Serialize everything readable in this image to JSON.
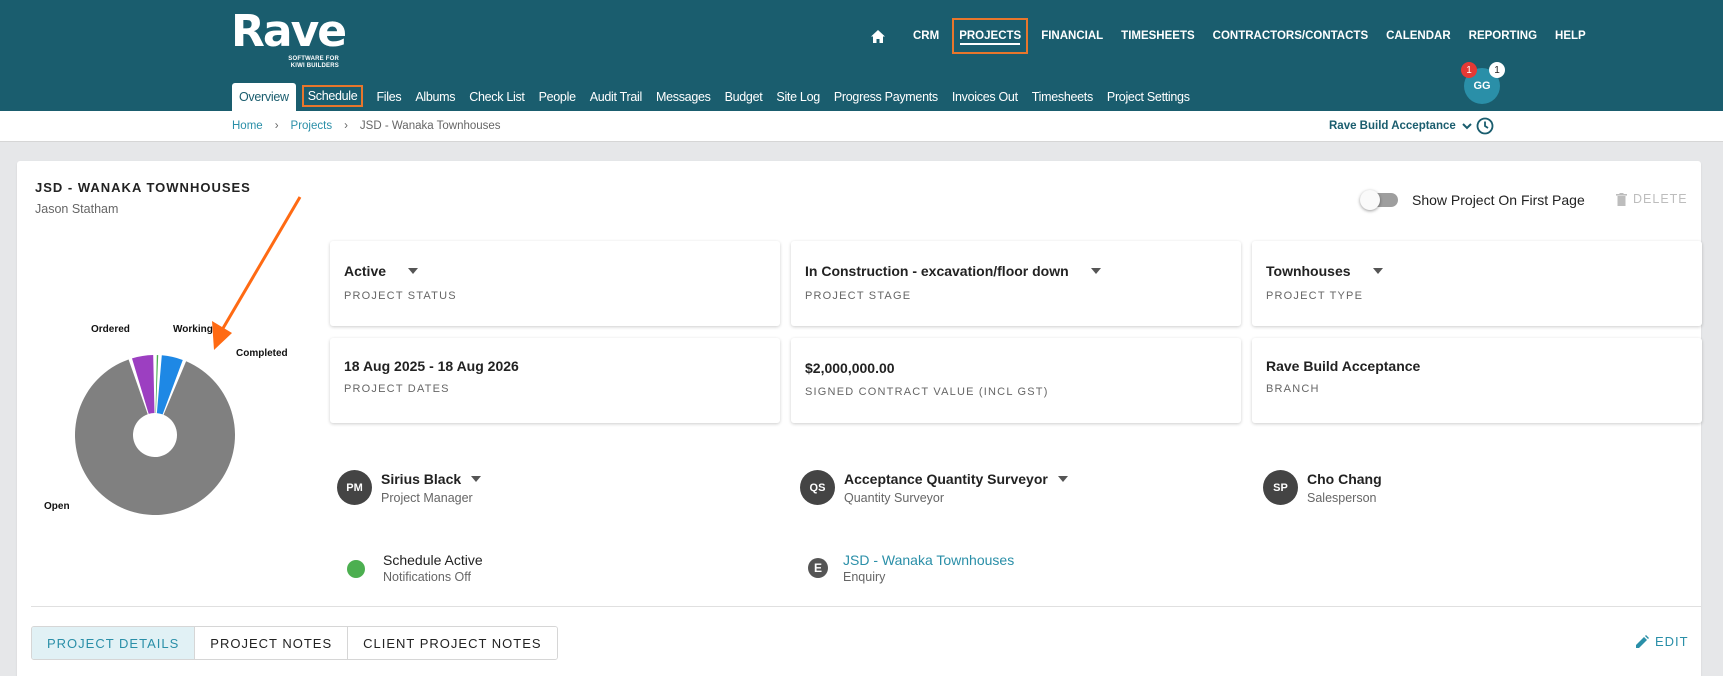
{
  "header": {
    "logo_word": "Rave",
    "logo_tagline": "SOFTWARE FOR KIWI BUILDERS",
    "nav": [
      "CRM",
      "PROJECTS",
      "FINANCIAL",
      "TIMESHEETS",
      "CONTRACTORS/CONTACTS",
      "CALENDAR",
      "REPORTING",
      "HELP"
    ],
    "active_nav": "PROJECTS",
    "user_initials": "GG",
    "badge_red": "1",
    "badge_white": "1"
  },
  "subnav": {
    "tabs": [
      "Overview",
      "Schedule",
      "Files",
      "Albums",
      "Check List",
      "People",
      "Audit Trail",
      "Messages",
      "Budget",
      "Site Log",
      "Progress Payments",
      "Invoices Out",
      "Timesheets",
      "Project Settings"
    ],
    "active": "Overview",
    "highlighted": "Schedule"
  },
  "breadcrumb": {
    "home": "Home",
    "projects": "Projects",
    "current": "JSD - Wanaka Townhouses",
    "branch": "Rave Build Acceptance"
  },
  "project": {
    "title": "JSD - WANAKA TOWNHOUSES",
    "owner": "Jason Statham",
    "show_first_page_label": "Show Project On First Page",
    "delete_label": "DELETE"
  },
  "info_cards": {
    "status": {
      "value": "Active",
      "label": "PROJECT STATUS"
    },
    "stage": {
      "value": "In Construction - excavation/floor down",
      "label": "PROJECT STAGE"
    },
    "type": {
      "value": "Townhouses",
      "label": "PROJECT TYPE"
    },
    "dates": {
      "value": "18 Aug 2025  - 18 Aug 2026",
      "label": "PROJECT DATES"
    },
    "contract": {
      "value": "$2,000,000.00",
      "label": "SIGNED CONTRACT VALUE (INCL GST)"
    },
    "branch": {
      "value": "Rave Build Acceptance",
      "label": "BRANCH"
    }
  },
  "people": {
    "pm": {
      "initials": "PM",
      "name": "Sirius Black",
      "role": "Project Manager"
    },
    "qs": {
      "initials": "QS",
      "name": "Acceptance Quantity Surveyor",
      "role": "Quantity Surveyor"
    },
    "sp": {
      "initials": "SP",
      "name": "Cho Chang",
      "role": "Salesperson"
    }
  },
  "schedule": {
    "title": "Schedule Active",
    "sub": "Notifications Off"
  },
  "enquiry": {
    "icon_letter": "E",
    "title": "JSD - Wanaka Townhouses",
    "sub": "Enquiry"
  },
  "bottom_tabs": [
    "PROJECT DETAILS",
    "PROJECT NOTES",
    "CLIENT PROJECT NOTES"
  ],
  "edit_label": "EDIT",
  "colors": {
    "brand": "#1a5d6e",
    "accent": "#e8762c",
    "link": "#2a8fa8",
    "open": "#808080",
    "ordered": "#9c3fc1",
    "working": "#4caf50",
    "completed": "#1e88e5"
  },
  "chart_data": {
    "type": "pie",
    "categories": [
      "Open",
      "Ordered",
      "Working",
      "Completed"
    ],
    "values": [
      89,
      5,
      1,
      5
    ],
    "colors": [
      "#808080",
      "#9c3fc1",
      "#4caf50",
      "#1e88e5"
    ],
    "title": "",
    "legend": "none"
  }
}
